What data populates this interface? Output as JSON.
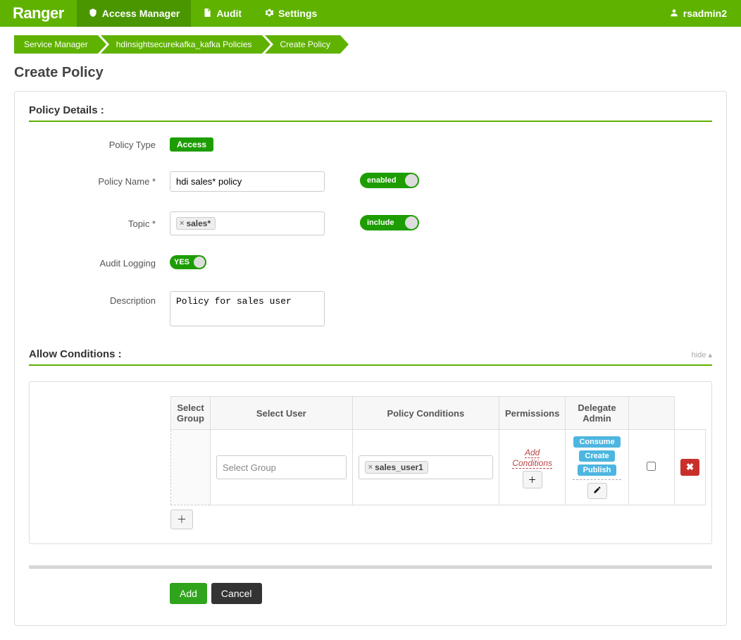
{
  "brand": "Ranger",
  "nav": {
    "access_manager": "Access Manager",
    "audit": "Audit",
    "settings": "Settings"
  },
  "user": "rsadmin2",
  "breadcrumb": {
    "a": "Service Manager",
    "b": "hdinsightsecurekafka_kafka Policies",
    "c": "Create Policy"
  },
  "page_title": "Create Policy",
  "section": {
    "policy_details": "Policy Details :",
    "allow_conditions": "Allow Conditions :"
  },
  "hide_label": "hide",
  "labels": {
    "policy_type": "Policy Type",
    "policy_name": "Policy Name *",
    "topic": "Topic *",
    "audit_logging": "Audit Logging",
    "description": "Description"
  },
  "form": {
    "policy_type_badge": "Access",
    "policy_name": "hdi sales* policy",
    "enabled_label": "enabled",
    "topic_tag": "sales*",
    "include_label": "include",
    "audit_yes": "YES",
    "description": "Policy for sales user"
  },
  "table": {
    "headers": {
      "select_group": "Select Group",
      "select_user": "Select User",
      "policy_conditions": "Policy Conditions",
      "permissions": "Permissions",
      "delegate_admin": "Delegate Admin"
    },
    "row": {
      "group_placeholder": "Select Group",
      "user_tag": "sales_user1",
      "add_conditions": "Add Conditions",
      "perm1": "Consume",
      "perm2": "Create",
      "perm3": "Publish"
    }
  },
  "buttons": {
    "add": "Add",
    "cancel": "Cancel"
  }
}
